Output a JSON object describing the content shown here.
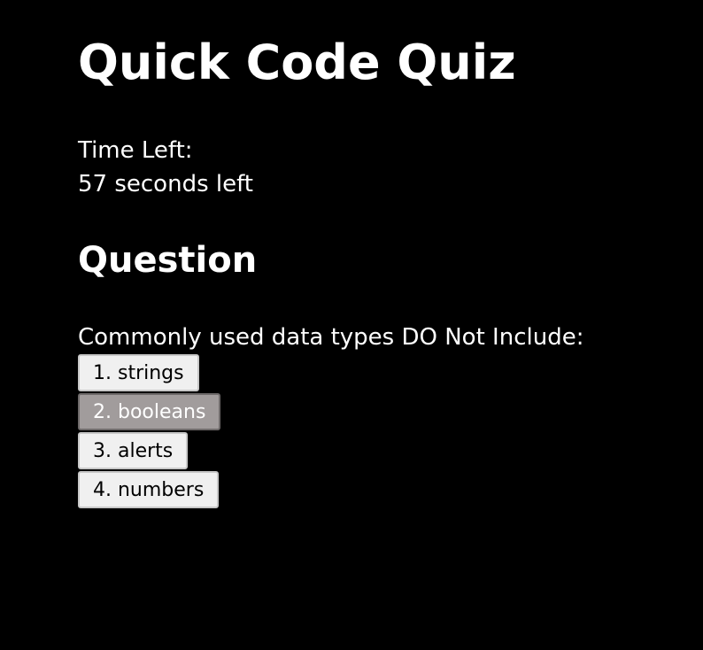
{
  "header": {
    "title": "Quick Code Quiz"
  },
  "timer": {
    "label": "Time Left:",
    "value": "57 seconds left"
  },
  "question": {
    "heading": "Question",
    "text": "Commonly used data types DO Not Include:",
    "answers": [
      {
        "label": "1. strings",
        "state": "normal"
      },
      {
        "label": "2. booleans",
        "state": "hover"
      },
      {
        "label": "3. alerts",
        "state": "normal"
      },
      {
        "label": "4. numbers",
        "state": "normal"
      }
    ]
  },
  "colors": {
    "background": "#000000",
    "text": "#ffffff",
    "button_bg": "#f0f0f0",
    "button_hover_bg": "#a19c9c"
  }
}
